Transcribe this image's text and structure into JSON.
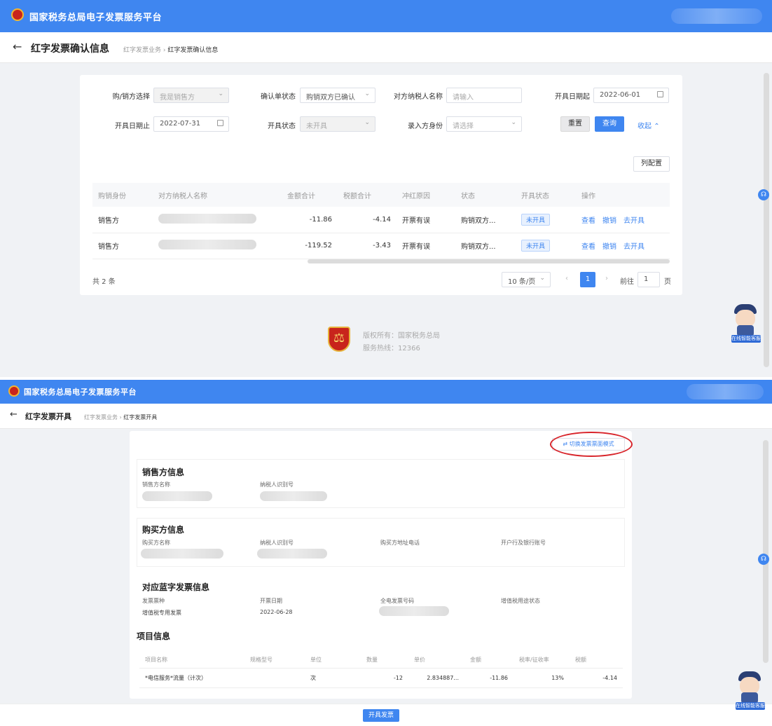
{
  "top": {
    "app_title": "国家税务总局电子发票服务平台",
    "page_title": "红字发票确认信息",
    "breadcrumb": {
      "parent": "红字发票业务",
      "current": "红字发票确认信息"
    },
    "filters": {
      "role_label": "购/销方选择",
      "role_value": "我是销售方",
      "confirm_status_label": "确认单状态",
      "confirm_status_value": "购销双方已确认",
      "counterpart_label": "对方纳税人名称",
      "counterpart_placeholder": "请输入",
      "date_start_label": "开具日期起",
      "date_start_value": "2022-06-01",
      "date_end_label": "开具日期止",
      "date_end_value": "2022-07-31",
      "issue_status_label": "开具状态",
      "issue_status_value": "未开具",
      "entry_party_label": "录入方身份",
      "entry_party_placeholder": "请选择",
      "reset_label": "重置",
      "query_label": "查询",
      "collapse_label": "收起"
    },
    "column_config_label": "列配置",
    "table": {
      "headers": [
        "购销身份",
        "对方纳税人名称",
        "金额合计",
        "税额合计",
        "冲红原因",
        "状态",
        "开具状态",
        "操作"
      ],
      "rows": [
        {
          "role": "销售方",
          "amount": "-11.86",
          "tax": "-4.14",
          "reason": "开票有误",
          "status": "购销双方...",
          "issue": "未开具",
          "op1": "查看",
          "op2": "撤销",
          "op3": "去开具"
        },
        {
          "role": "销售方",
          "amount": "-119.52",
          "tax": "-3.43",
          "reason": "开票有误",
          "status": "购销双方...",
          "issue": "未开具",
          "op1": "查看",
          "op2": "撤销",
          "op3": "去开具"
        }
      ]
    },
    "total_text": "共 2 条",
    "pager": {
      "page_size": "10 条/页",
      "current": "1",
      "goto_label": "前往",
      "goto_value": "1",
      "page_unit": "页"
    },
    "footer": {
      "copyright": "版权所有：国家税务总局",
      "hotline": "服务热线：12366"
    },
    "assistant_label": "在线智能客服"
  },
  "bottom": {
    "app_title": "国家税务总局电子发票服务平台",
    "page_title": "红字发票开具",
    "breadcrumb": {
      "parent": "红字发票业务",
      "current": "红字发票开具"
    },
    "switch_button": "切换发票票面模式",
    "seller": {
      "title": "销售方信息",
      "name_label": "销售方名称",
      "id_label": "纳税人识别号"
    },
    "buyer": {
      "title": "购买方信息",
      "name_label": "购买方名称",
      "id_label": "纳税人识别号",
      "addr_label": "购买方地址电话",
      "bank_label": "开户行及银行账号"
    },
    "blue_invoice": {
      "title": "对应蓝字发票信息",
      "type_label": "发票票种",
      "type_value": "增值税专用发票",
      "date_label": "开票日期",
      "date_value": "2022-06-28",
      "number_label": "全电发票号码",
      "usage_label": "增值税用途状态"
    },
    "items": {
      "title": "项目信息",
      "headers": [
        "项目名称",
        "规格型号",
        "单位",
        "数量",
        "单价",
        "金额",
        "税率/征收率",
        "税额"
      ],
      "row": {
        "name": "*电信服务*流量（计次）",
        "spec": "",
        "unit": "次",
        "qty": "-12",
        "price": "2.834887...",
        "amount": "-11.86",
        "rate": "13%",
        "tax": "-4.14"
      }
    },
    "submit_label": "开具发票",
    "assistant_label": "在线智能客服"
  }
}
